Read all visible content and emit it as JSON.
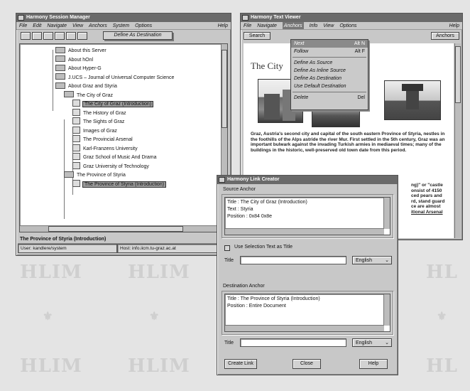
{
  "session_manager": {
    "title": "Harmony Session Manager",
    "menus": [
      "File",
      "Edit",
      "Navigate",
      "View",
      "Anchors",
      "System",
      "Options"
    ],
    "help": "Help",
    "tooltip": "Define As Destination",
    "tree": [
      {
        "label": "About this Server",
        "type": "folder"
      },
      {
        "label": "About hOnl",
        "type": "folder"
      },
      {
        "label": "About Hyper-G",
        "type": "folder"
      },
      {
        "label": "J.UCS – Journal of Universal Computer Science",
        "type": "folder"
      },
      {
        "label": "About Graz and Styria",
        "type": "folder"
      },
      {
        "label": "The City of Graz",
        "type": "folder"
      },
      {
        "label": "The City of Graz (Introduction)",
        "type": "doc",
        "selected": true
      },
      {
        "label": "The History of Graz",
        "type": "doc"
      },
      {
        "label": "The Sights of Graz",
        "type": "doc"
      },
      {
        "label": "Images of Graz",
        "type": "doc"
      },
      {
        "label": "The Provincial Arsenal",
        "type": "doc"
      },
      {
        "label": "Karl-Franzens University",
        "type": "doc"
      },
      {
        "label": "Graz School of Music And Drama",
        "type": "doc"
      },
      {
        "label": "Graz University of Technology",
        "type": "doc"
      },
      {
        "label": "The Province of Styria",
        "type": "folder"
      },
      {
        "label": "The Province of Styria (Introduction)",
        "type": "doc",
        "selected": true
      }
    ],
    "status_title": "The Province of Styria (Introduction)",
    "status_user": "User: kandlere/system",
    "status_host": "Host: info.iicm.tu-graz.ac.at"
  },
  "text_viewer": {
    "title": "Harmony Text Viewer",
    "menus": [
      "File",
      "Navigate",
      "Anchors",
      "Info",
      "View",
      "Options"
    ],
    "help": "Help",
    "search_button": "Search",
    "anchors_button": "Anchors",
    "heading": "The City",
    "anchors_menu": [
      {
        "label": "Next",
        "accel": "Alt N"
      },
      {
        "label": "Follow",
        "accel": "Alt F"
      },
      {
        "sep": true
      },
      {
        "label": "Define As Source"
      },
      {
        "label": "Define As Inline Source"
      },
      {
        "label": "Define As Destination"
      },
      {
        "label": "Use Default Destination"
      },
      {
        "sep": true
      },
      {
        "label": "Delete",
        "accel": "Del"
      }
    ],
    "paragraph": "Graz, Austria's second city and capital of the south eastern Province of Styria, nestles in the foothills of the Alps astride the river Mur. First settled in the 5th century, Graz was an important bulwark against the invading Turkish armies in mediaeval times; many of the buildings in the historic, well-preserved old town date from this period.",
    "right_snippets": [
      "ng)\" or \"castle",
      "onsist of 4150",
      "ced pears and",
      "rd, stand guard",
      "ce are almost",
      "itional Arsenal"
    ]
  },
  "link_creator": {
    "title": "Harmony Link Creator",
    "source_label": "Source Anchor",
    "source_lines": [
      "Title : The City of Graz (Introduction)",
      "Text : Styria",
      "Position : 0x84 0x8e"
    ],
    "use_selection_label": "Use Selection Text as Title",
    "title_label": "Title",
    "language": "English",
    "dest_label": "Destination Anchor",
    "dest_lines": [
      "Title : The Province of Styria (Introduction)",
      "Position : Entire Document"
    ],
    "dest_title_label": "Title",
    "dest_language": "English",
    "create_button": "Create Link",
    "close_button": "Close",
    "help_button": "Help"
  },
  "watermark": [
    "HLIM",
    "HLIM",
    "HLIM",
    "HLIM"
  ],
  "colors": {
    "titlebar": "#6a6a6a",
    "window": "#c8c8c8",
    "desktop": "#e4e4e4"
  }
}
